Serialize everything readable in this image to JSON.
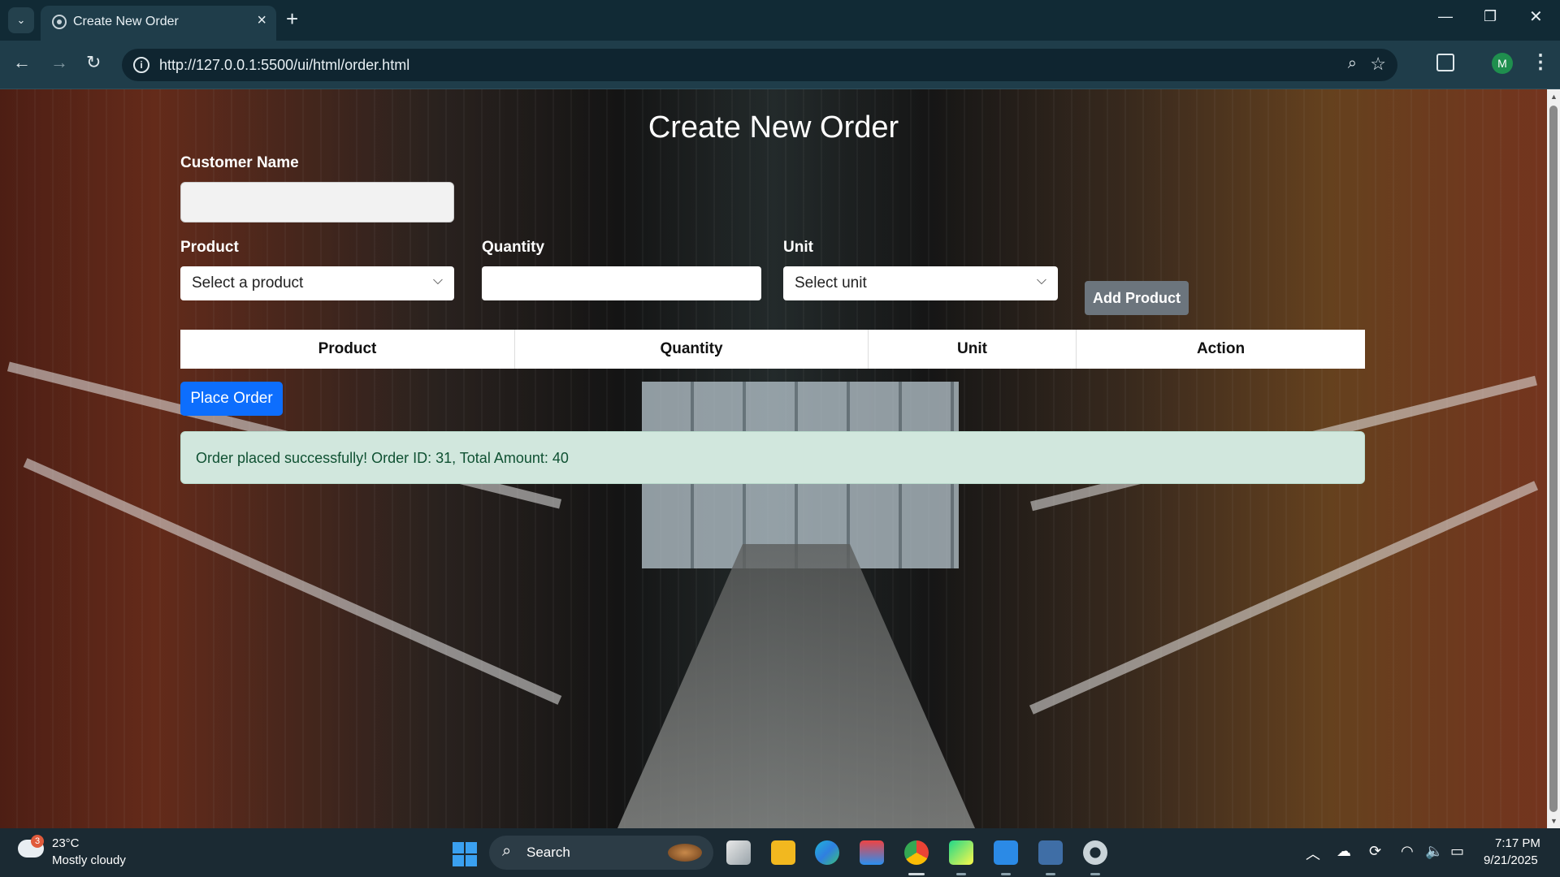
{
  "browser": {
    "tab_title": "Create New Order",
    "url": "http://127.0.0.1:5500/ui/html/order.html",
    "profile_initial": "M"
  },
  "page": {
    "title": "Create New Order",
    "customer_name_label": "Customer Name",
    "customer_name_value": "",
    "product_label": "Product",
    "product_select_value": "Select a product",
    "quantity_label": "Quantity",
    "quantity_value": "",
    "unit_label": "Unit",
    "unit_select_value": "Select unit",
    "add_product_label": "Add Product",
    "table": {
      "headers": [
        "Product",
        "Quantity",
        "Unit",
        "Action"
      ],
      "rows": []
    },
    "place_order_label": "Place Order",
    "alert_message": "Order placed successfully! Order ID: 31, Total Amount: 40"
  },
  "taskbar": {
    "weather_temp": "23°C",
    "weather_desc": "Mostly cloudy",
    "weather_badge": "3",
    "search_label": "Search",
    "time": "7:17 PM",
    "date": "9/21/2025"
  },
  "colors": {
    "primary_button": "#0d6efd",
    "secondary_button": "#6c757d",
    "success_alert_bg": "#d1e7dd",
    "success_alert_text": "#0f5132",
    "chrome_dark": "#112a35"
  },
  "icons": [
    "tab-search-icon",
    "close-icon",
    "new-tab-icon",
    "minimize-icon",
    "restore-icon",
    "window-close-icon",
    "back-icon",
    "forward-icon",
    "reload-icon",
    "site-info-icon",
    "zoom-icon",
    "bookmark-star-icon",
    "extensions-icon",
    "menu-kebab-icon",
    "chevron-down-icon",
    "windows-start-icon",
    "search-icon"
  ]
}
